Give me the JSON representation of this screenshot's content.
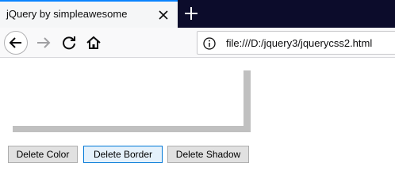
{
  "browser": {
    "tab_title": "jQuery by simpleawesome",
    "url": "file:///D:/jquery3/jquerycss2.html",
    "icons": {
      "tab_close": "close-icon",
      "new_tab": "plus-icon",
      "back": "back-arrow-icon",
      "forward": "forward-arrow-icon",
      "reload": "reload-icon",
      "home": "home-icon",
      "site_info": "info-icon"
    }
  },
  "page": {
    "buttons": {
      "delete_color": "Delete Color",
      "delete_border": "Delete Border",
      "delete_shadow": "Delete Shadow"
    }
  },
  "colors": {
    "shadow": "#c0c0c0",
    "tab_accent": "#0a84ff",
    "tabbar_bg": "#0c0c2b"
  }
}
